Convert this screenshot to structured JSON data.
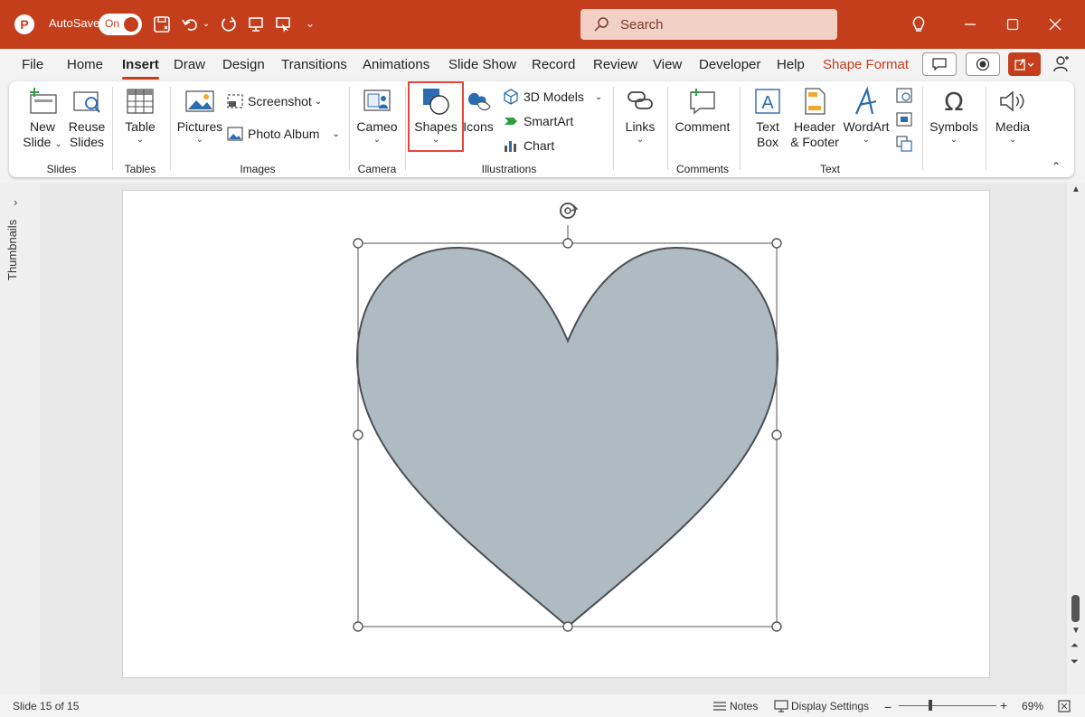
{
  "titlebar": {
    "autosave_label": "AutoSave",
    "autosave_state": "On",
    "search_placeholder": "Search"
  },
  "tabs": [
    "File",
    "Home",
    "Insert",
    "Draw",
    "Design",
    "Transitions",
    "Animations",
    "Slide Show",
    "Record",
    "Review",
    "View",
    "Developer",
    "Help",
    "Shape Format"
  ],
  "active_tab": "Insert",
  "ribbon": {
    "slides": {
      "new_slide": [
        "New",
        "Slide"
      ],
      "reuse_slides": [
        "Reuse",
        "Slides"
      ],
      "group": "Slides"
    },
    "tables": {
      "table": "Table",
      "group": "Tables"
    },
    "images": {
      "pictures": "Pictures",
      "screenshot": "Screenshot",
      "photo_album": "Photo Album",
      "group": "Images"
    },
    "camera": {
      "cameo": "Cameo",
      "group": "Camera"
    },
    "illustrations": {
      "shapes": "Shapes",
      "icons": "Icons",
      "models_3d": "3D Models",
      "smartart": "SmartArt",
      "chart": "Chart",
      "group": "Illustrations"
    },
    "links": {
      "links": "Links"
    },
    "comments": {
      "comment": "Comment",
      "group": "Comments"
    },
    "text": {
      "text_box": [
        "Text",
        "Box"
      ],
      "header_footer": [
        "Header",
        "& Footer"
      ],
      "wordart": "WordArt",
      "group": "Text"
    },
    "symbols": {
      "symbols": "Symbols"
    },
    "media": {
      "media": "Media"
    }
  },
  "sidebar": {
    "thumbnails_label": "Thumbnails"
  },
  "slide": {
    "shape": "heart",
    "shape_fill": "#aebbc3",
    "shape_stroke": "#4a4f54"
  },
  "statusbar": {
    "slide_info": "Slide 15 of 15",
    "notes": "Notes",
    "display_settings": "Display Settings",
    "zoom": "69%"
  },
  "colors": {
    "accent": "#c43e1c",
    "highlight": "#e5473c"
  }
}
